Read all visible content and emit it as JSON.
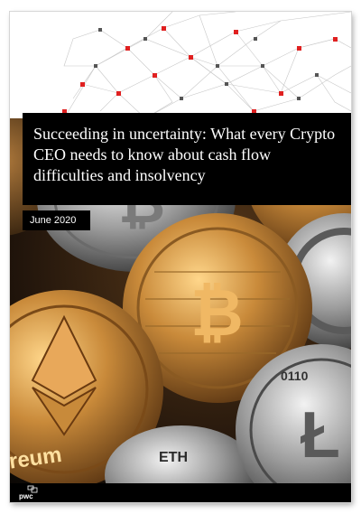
{
  "cover": {
    "title": "Succeeding in uncertainty: What every Crypto CEO needs to know about cash flow difficulties and insolvency",
    "date": "June 2020",
    "brand": "pwc"
  },
  "image_text": {
    "eth_coin": "reum",
    "eth_badge": "ETH",
    "lite_coin": "0110"
  },
  "colors": {
    "title_background": "#000000",
    "network_accent": "#e02020",
    "network_node": "#555555",
    "coin_gold": "#c98a3a",
    "coin_silver": "#b8b8b8"
  },
  "icons": [
    "pwc-logo-icon"
  ]
}
